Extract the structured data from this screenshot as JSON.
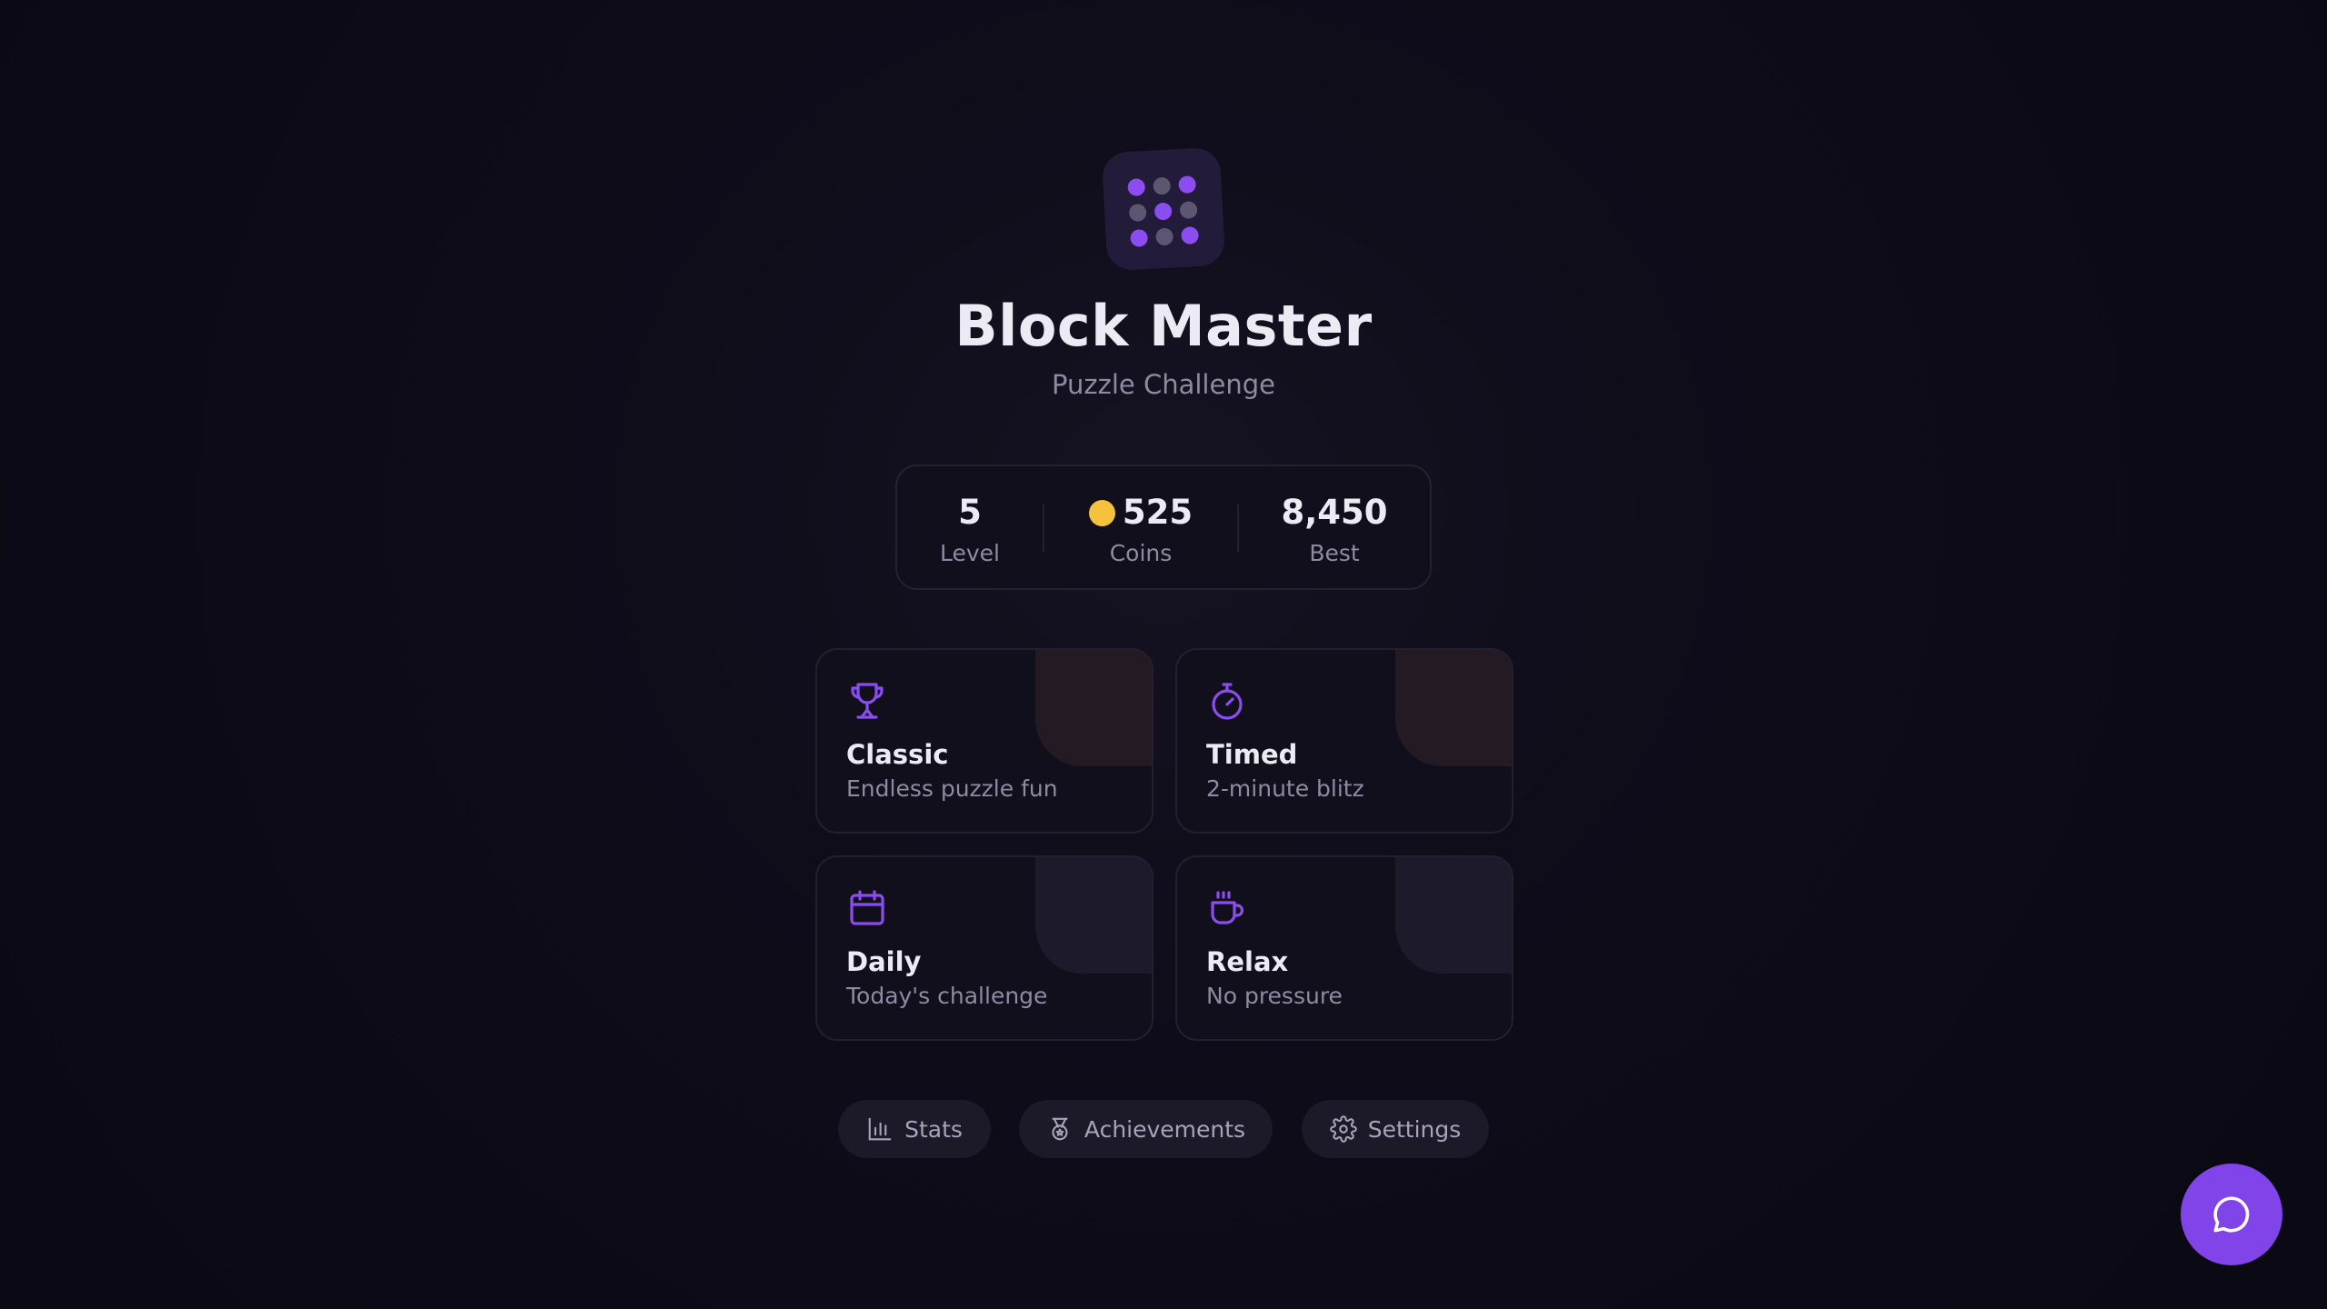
{
  "app": {
    "title": "Block Master",
    "subtitle": "Puzzle Challenge",
    "accent": "#8b4df0",
    "coin_color": "#f4c23d"
  },
  "logo": {
    "icon": "block-grid-icon"
  },
  "stats": [
    {
      "value": "5",
      "label": "Level"
    },
    {
      "value": "525",
      "label": "Coins",
      "icon": "coin-icon"
    },
    {
      "value": "8,450",
      "label": "Best"
    }
  ],
  "modes": [
    {
      "name": "Classic",
      "desc": "Endless puzzle fun",
      "icon": "trophy-icon"
    },
    {
      "name": "Timed",
      "desc": "2-minute blitz",
      "icon": "stopwatch-icon"
    },
    {
      "name": "Daily",
      "desc": "Today's challenge",
      "icon": "calendar-icon"
    },
    {
      "name": "Relax",
      "desc": "No pressure",
      "icon": "coffee-icon"
    }
  ],
  "nav": [
    {
      "label": "Stats",
      "icon": "bar-chart-icon"
    },
    {
      "label": "Achievements",
      "icon": "medal-icon"
    },
    {
      "label": "Settings",
      "icon": "gear-icon"
    }
  ],
  "chat": {
    "icon": "chat-bubble-icon"
  }
}
